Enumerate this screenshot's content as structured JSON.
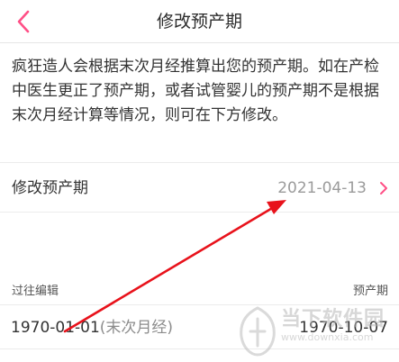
{
  "nav": {
    "title": "修改预产期",
    "back_icon": "chevron-left-icon",
    "accent": "#ff4f86"
  },
  "description": "疯狂造人会根据末次月经推算出您的预产期。如在产检中医生更正了预产期，或者试管婴儿的预产期不是根据末次月经计算等情况，则可在下方修改。",
  "due_date_row": {
    "label": "修改预产期",
    "value": "2021-04-13",
    "chevron_icon": "chevron-right-icon"
  },
  "history": {
    "left_header": "过往编辑",
    "right_header": "预产期",
    "rows": [
      {
        "date": "1970-01-01",
        "note": "(末次月经)",
        "due": "1970-10-07"
      }
    ]
  },
  "watermark": {
    "brand": "当下软件园",
    "site": "www.downxia.com"
  },
  "annotation": {
    "color": "#e8121b"
  }
}
